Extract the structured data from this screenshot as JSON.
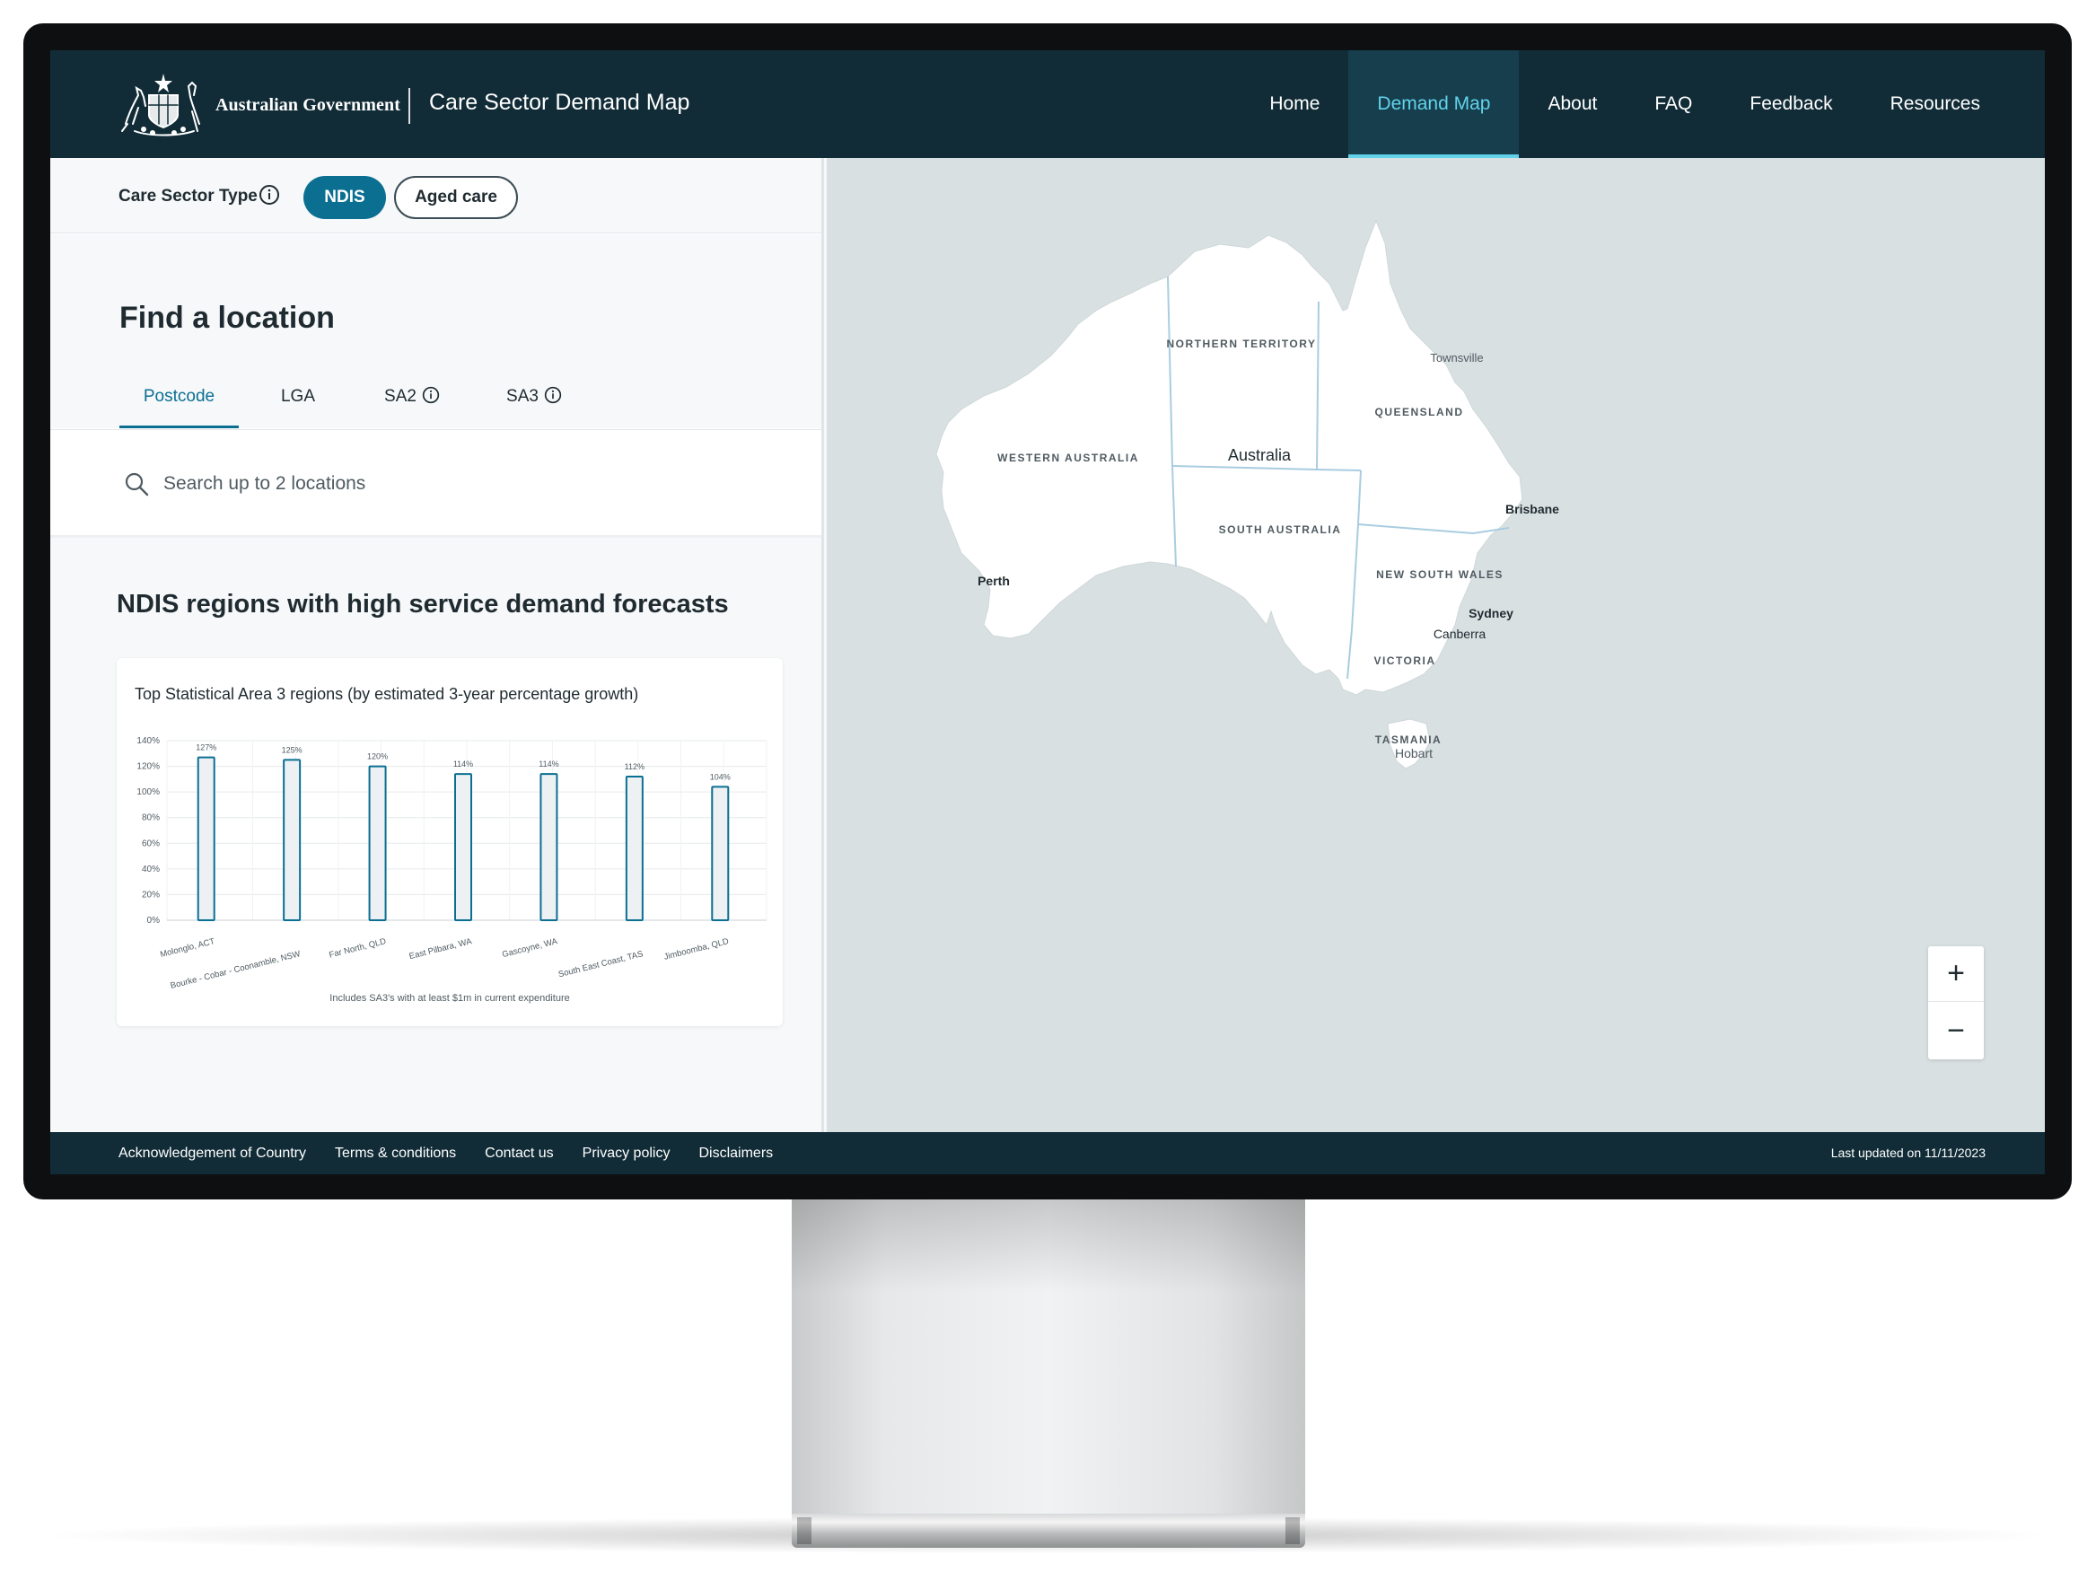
{
  "header": {
    "gov_name": "Australian Government",
    "app_title": "Care Sector Demand Map",
    "nav": [
      {
        "label": "Home"
      },
      {
        "label": "Demand Map",
        "active": true
      },
      {
        "label": "About"
      },
      {
        "label": "FAQ"
      },
      {
        "label": "Feedback"
      },
      {
        "label": "Resources"
      }
    ]
  },
  "sector": {
    "label": "Care Sector Type",
    "options": [
      {
        "label": "NDIS",
        "selected": true
      },
      {
        "label": "Aged care",
        "selected": false
      }
    ]
  },
  "find": {
    "title": "Find a location",
    "tabs": [
      {
        "label": "Postcode",
        "active": true,
        "info": false
      },
      {
        "label": "LGA",
        "active": false,
        "info": false
      },
      {
        "label": "SA2",
        "active": false,
        "info": true
      },
      {
        "label": "SA3",
        "active": false,
        "info": true
      }
    ],
    "search_placeholder": "Search up to 2 locations"
  },
  "demand": {
    "title": "NDIS regions with high service demand forecasts"
  },
  "chart_data": {
    "type": "bar",
    "title": "Top Statistical Area 3 regions (by estimated 3-year percentage growth)",
    "categories": [
      "Molonglo, ACT",
      "Bourke - Cobar - Coonamble, NSW",
      "Far North, QLD",
      "East Pilbara, WA",
      "Gascoyne, WA",
      "South East Coast, TAS",
      "Jimboomba, QLD"
    ],
    "values": [
      127,
      125,
      120,
      114,
      114,
      112,
      104
    ],
    "value_labels": [
      "127%",
      "125%",
      "120%",
      "114%",
      "114%",
      "112%",
      "104%"
    ],
    "yticks": [
      "0%",
      "20%",
      "40%",
      "60%",
      "80%",
      "100%",
      "120%",
      "140%"
    ],
    "ylim": [
      0,
      140
    ],
    "grid": true,
    "note": "Includes SA3's with at least $1m in current expenditure",
    "colors": {
      "bar_fill": "#edf1f3",
      "bar_stroke": "#0b6f92"
    }
  },
  "map": {
    "country_label": "Australia",
    "states": [
      "WESTERN AUSTRALIA",
      "NORTHERN TERRITORY",
      "SOUTH AUSTRALIA",
      "QUEENSLAND",
      "NEW SOUTH WALES",
      "VICTORIA",
      "TASMANIA"
    ],
    "cities": [
      "Perth",
      "Townsville",
      "Brisbane",
      "Sydney",
      "Canberra",
      "Hobart"
    ],
    "zoom_in_label": "+",
    "zoom_out_label": "−"
  },
  "footer": {
    "links": [
      "Acknowledgement of Country",
      "Terms & conditions",
      "Contact us",
      "Privacy policy",
      "Disclaimers"
    ],
    "last_updated": "Last updated on 11/11/2023"
  },
  "colors": {
    "header_bg": "#112c37",
    "accent": "#0b6f92",
    "nav_active": "#62d2ea",
    "map_sea": "#d9e0e2",
    "map_land": "#ffffff",
    "border_line": "#a9cde0"
  }
}
